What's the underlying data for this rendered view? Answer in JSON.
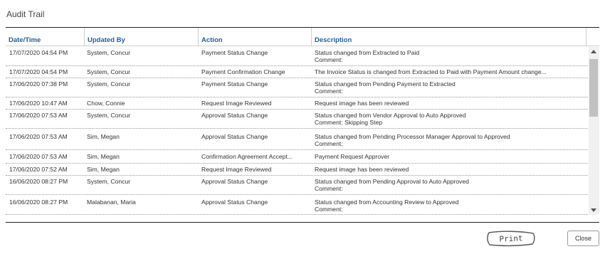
{
  "dialog": {
    "title": "Audit Trail"
  },
  "table": {
    "columns": [
      "Date/Time",
      "Updated By",
      "Action",
      "Description"
    ],
    "rows": [
      {
        "date": "17/07/2020 04:54 PM",
        "by": "System, Concur",
        "action": "Payment Status Change",
        "desc1": "Status changed from Extracted to Paid",
        "desc2": "Comment:"
      },
      {
        "date": "17/07/2020 04:54 PM",
        "by": "System, Concur",
        "action": "Payment Confirmation Change",
        "desc1": "The Invoice Status is changed from Extracted to Paid with Payment Amount change...",
        "desc2": ""
      },
      {
        "date": "17/06/2020 07:38 PM",
        "by": "System, Concur",
        "action": "Payment Status Change",
        "desc1": "Status changed from Pending Payment to Extracted",
        "desc2": "Comment:"
      },
      {
        "date": "17/06/2020 10:47 AM",
        "by": "Chow, Connie",
        "action": "Request Image Reviewed",
        "desc1": "Request image has been reviewed",
        "desc2": ""
      },
      {
        "date": "17/06/2020 07:53 AM",
        "by": "System, Concur",
        "action": "Approval Status Change",
        "desc1": "Status changed from Vendor Approval to Auto Approved",
        "desc2": "Comment: Skipping Step"
      },
      {
        "date": "17/06/2020 07:53 AM",
        "by": "Sim, Megan",
        "action": "Approval Status Change",
        "desc1": "Status changed from Pending Processor Manager Approval to Approved",
        "desc2": "Comment:"
      },
      {
        "date": "17/06/2020 07:53 AM",
        "by": "Sim, Megan",
        "action": "Confirmation Agreement Accept...",
        "desc1": "Payment Request Approver",
        "desc2": ""
      },
      {
        "date": "17/06/2020 07:52 AM",
        "by": "Sim, Megan",
        "action": "Request Image Reviewed",
        "desc1": "Request image has been reviewed",
        "desc2": ""
      },
      {
        "date": "16/06/2020 08:27 PM",
        "by": "System, Concur",
        "action": "Approval Status Change",
        "desc1": "Status changed from Pending Approval to Auto Approved",
        "desc2": "Comment:"
      },
      {
        "date": "16/06/2020 08:27 PM",
        "by": "Malabanan, Maria",
        "action": "Approval Status Change",
        "desc1": "Status changed from Accounting Review to Approved",
        "desc2": "Comment:"
      }
    ]
  },
  "buttons": {
    "print_label": "Print",
    "close_label": "Close"
  }
}
